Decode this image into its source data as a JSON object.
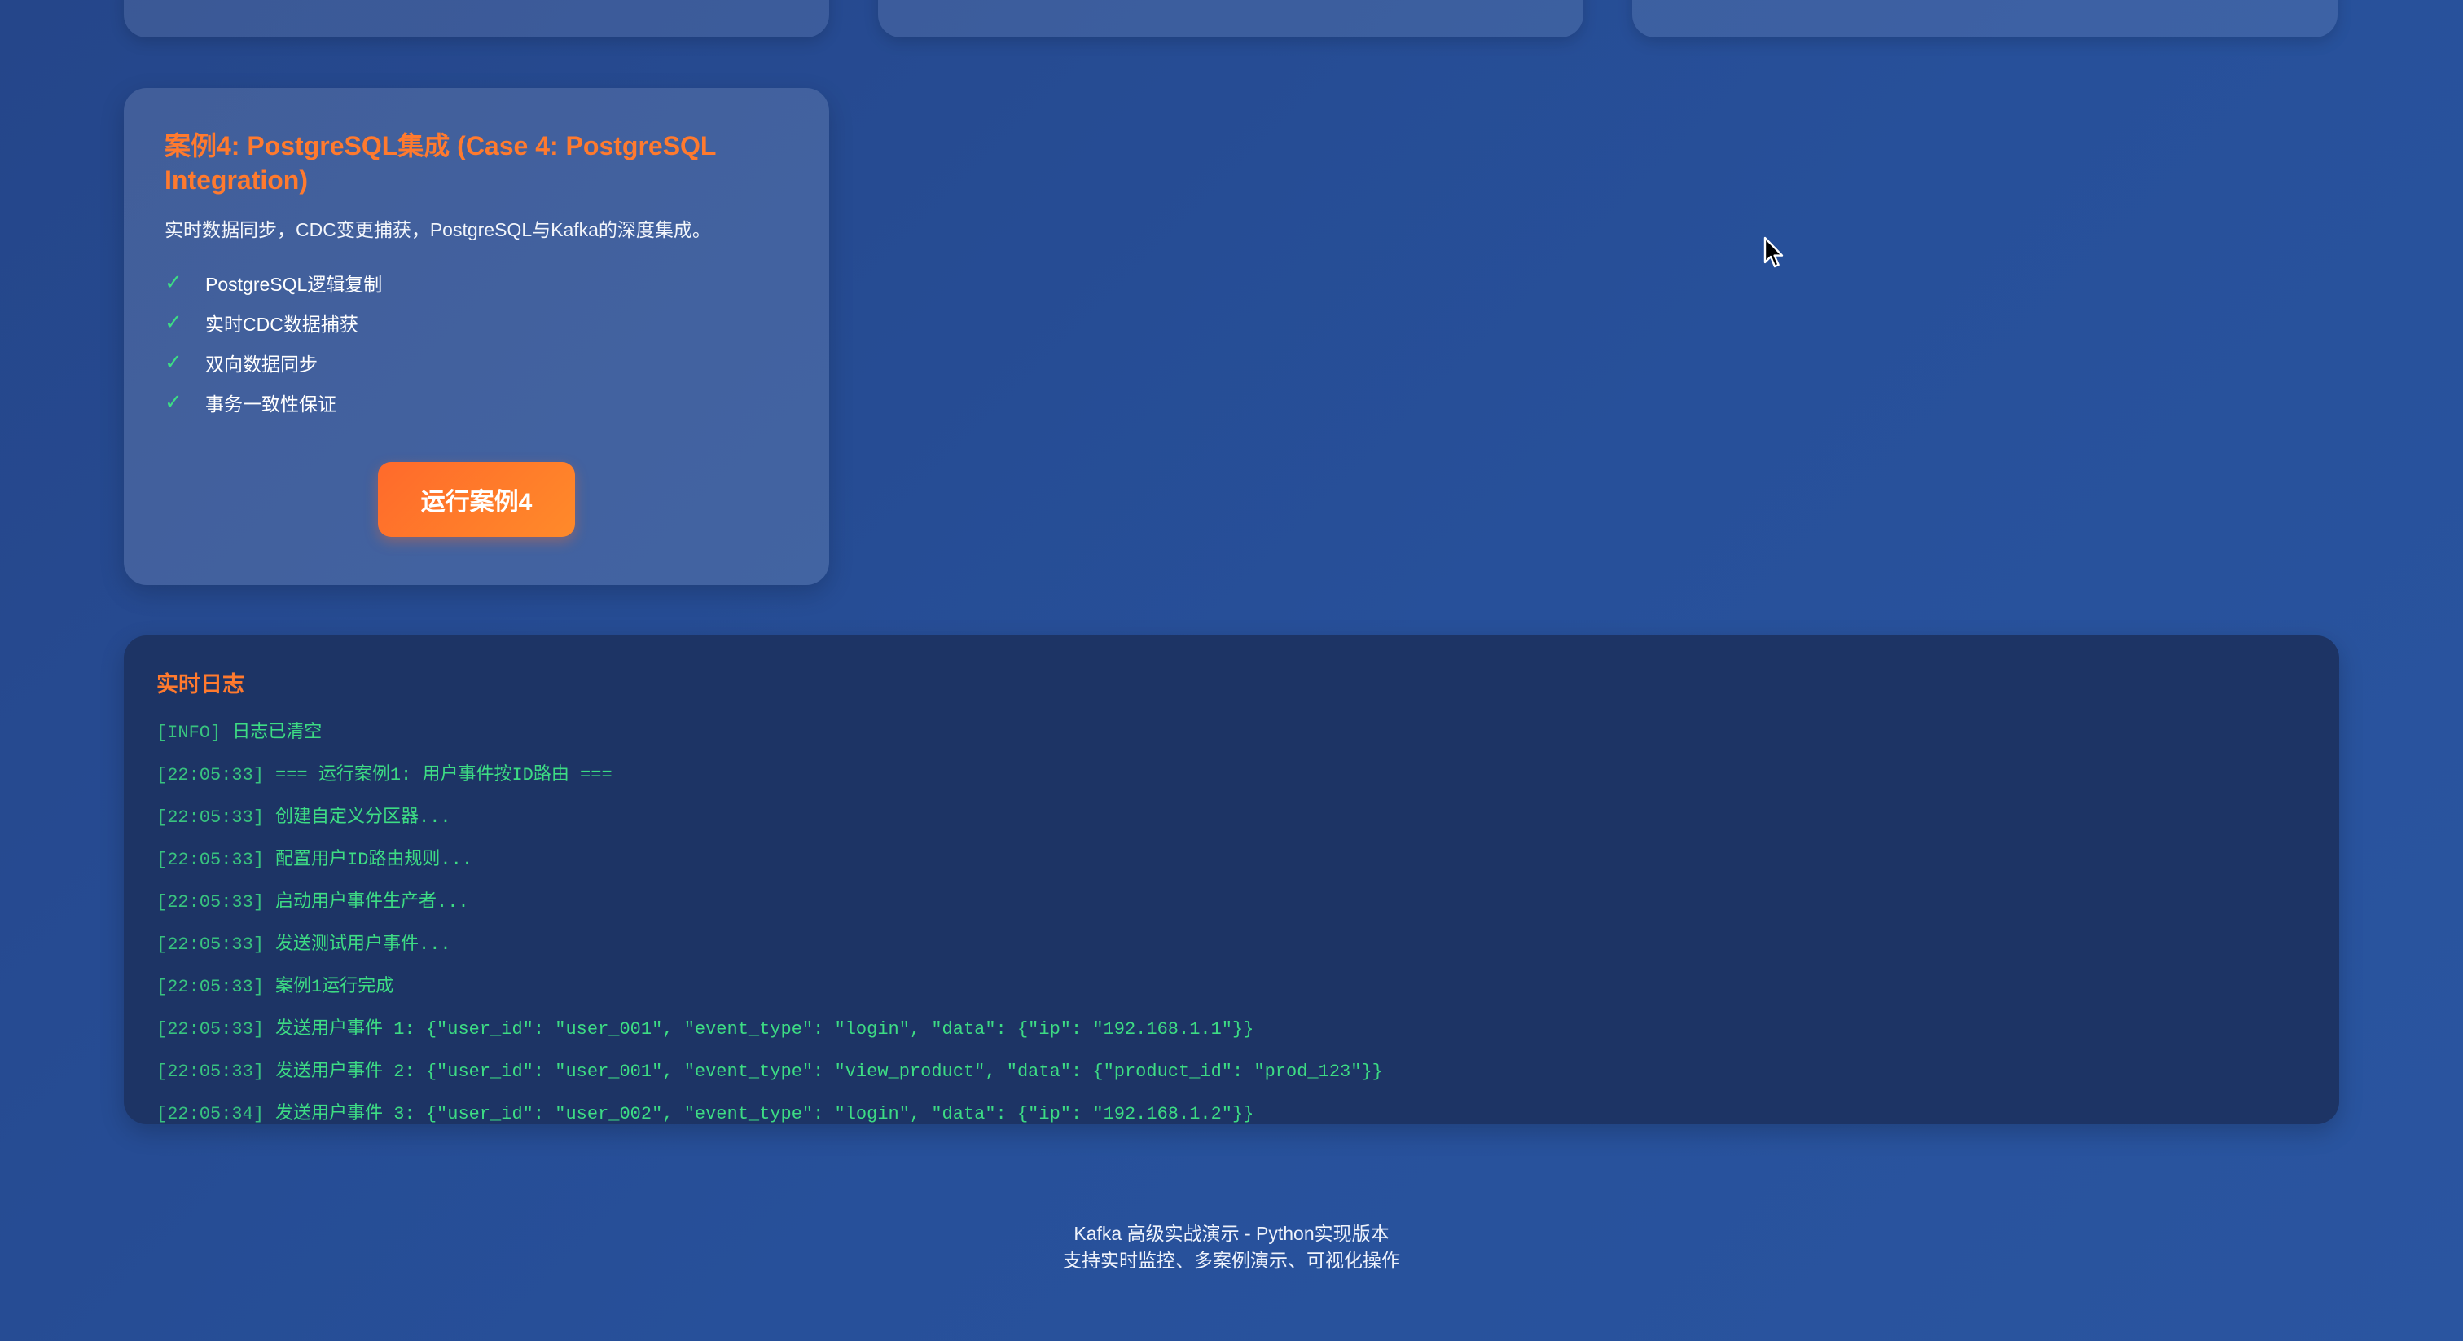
{
  "case4": {
    "title": "案例4: PostgreSQL集成 (Case 4: PostgreSQL Integration)",
    "description": "实时数据同步，CDC变更捕获，PostgreSQL与Kafka的深度集成。",
    "features": [
      "PostgreSQL逻辑复制",
      "实时CDC数据捕获",
      "双向数据同步",
      "事务一致性保证"
    ],
    "check_icon": "✓",
    "run_button_label": "运行案例4"
  },
  "log": {
    "title": "实时日志",
    "lines": [
      {
        "ts": "[INFO]",
        "msg": "日志已清空"
      },
      {
        "ts": "[22:05:33]",
        "msg": "=== 运行案例1: 用户事件按ID路由 ==="
      },
      {
        "ts": "[22:05:33]",
        "msg": "创建自定义分区器..."
      },
      {
        "ts": "[22:05:33]",
        "msg": "配置用户ID路由规则..."
      },
      {
        "ts": "[22:05:33]",
        "msg": "启动用户事件生产者..."
      },
      {
        "ts": "[22:05:33]",
        "msg": "发送测试用户事件..."
      },
      {
        "ts": "[22:05:33]",
        "msg": "案例1运行完成"
      },
      {
        "ts": "[22:05:33]",
        "msg": "发送用户事件 1: {\"user_id\": \"user_001\", \"event_type\": \"login\", \"data\": {\"ip\": \"192.168.1.1\"}}"
      },
      {
        "ts": "[22:05:33]",
        "msg": "发送用户事件 2: {\"user_id\": \"user_001\", \"event_type\": \"view_product\", \"data\": {\"product_id\": \"prod_123\"}}"
      },
      {
        "ts": "[22:05:34]",
        "msg": "发送用户事件 3: {\"user_id\": \"user_002\", \"event_type\": \"login\", \"data\": {\"ip\": \"192.168.1.2\"}}"
      }
    ]
  },
  "footer": {
    "line1": "Kafka 高级实战演示 - Python实现版本",
    "line2": "支持实时监控、多案例演示、可视化操作"
  },
  "colors": {
    "accent_orange": "#ff7a2e",
    "log_green": "#3ddc84",
    "log_panel_bg": "#1d3465"
  }
}
